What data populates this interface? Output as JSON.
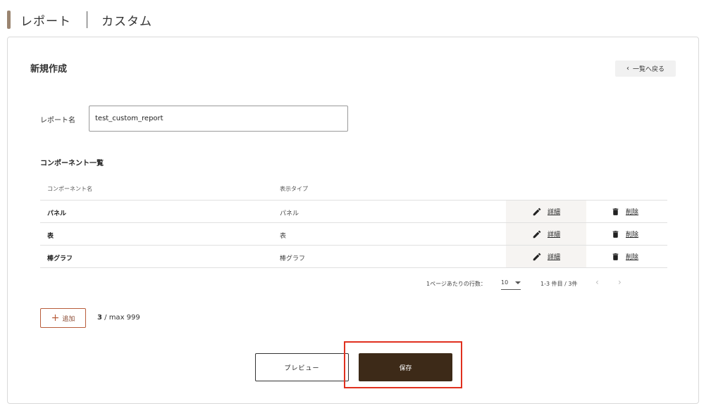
{
  "header": {
    "title": "レポート",
    "subtitle": "カスタム"
  },
  "card": {
    "title": "新規作成",
    "back_label": "一覧へ戻る"
  },
  "report_name": {
    "label": "レポート名",
    "value": "test_custom_report"
  },
  "components": {
    "title": "コンポーネント一覧",
    "columns": [
      "コンポーネント名",
      "表示タイプ"
    ],
    "rows": [
      {
        "name": "パネル",
        "type": "パネル",
        "detail": "詳細",
        "delete": "削除"
      },
      {
        "name": "表",
        "type": "表",
        "detail": "詳細",
        "delete": "削除"
      },
      {
        "name": "棒グラフ",
        "type": "棒グラフ",
        "detail": "詳細",
        "delete": "削除"
      }
    ]
  },
  "pagination": {
    "rows_per_page_label": "1ページあたりの行数：",
    "rows_per_page": "10",
    "range": "1-3 件目 / 3件"
  },
  "add": {
    "label": "追加",
    "count": "3",
    "max": " / max 999"
  },
  "actions": {
    "preview": "プレビュー",
    "save": "保存"
  },
  "colors": {
    "accent": "#9a8470",
    "primary": "#3d2a18",
    "add_border": "#b85c3a",
    "highlight": "#e0301e"
  }
}
